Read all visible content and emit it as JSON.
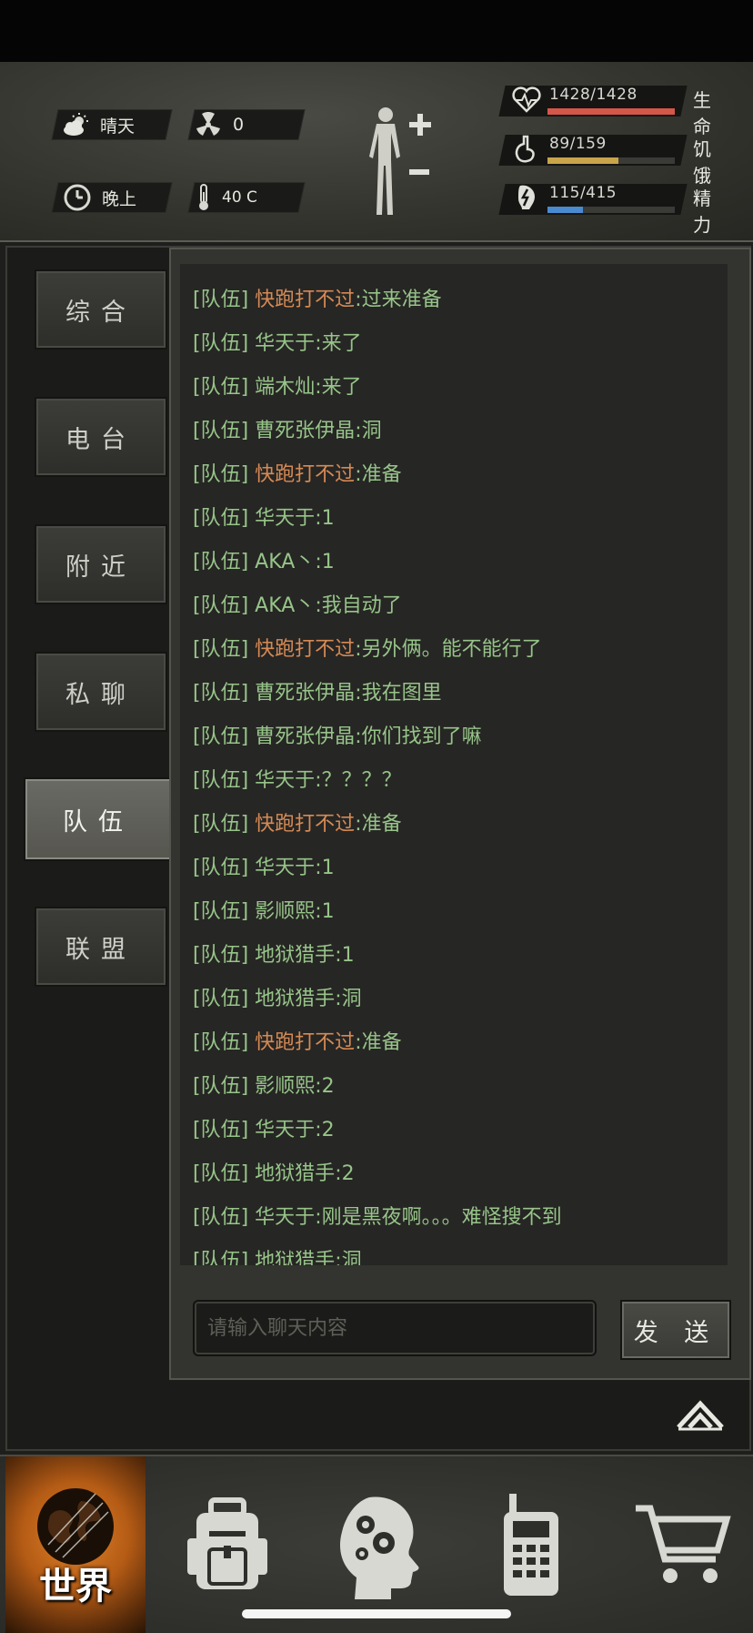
{
  "status": {
    "weather": "晴天",
    "radiation": "0",
    "time_of_day": "晚上",
    "temperature": "40 C"
  },
  "stats": [
    {
      "value": "1428/1428",
      "label": "生命",
      "fill": 1.0,
      "color": "#d4574a",
      "icon": "heart-icon"
    },
    {
      "value": "89/159",
      "label": "饥饿",
      "fill": 0.56,
      "color": "#c8a44a",
      "icon": "stomach-icon"
    },
    {
      "value": "115/415",
      "label": "精力",
      "fill": 0.28,
      "color": "#4a8ad0",
      "icon": "energy-icon"
    }
  ],
  "tabs": [
    {
      "label": "综合",
      "active": false
    },
    {
      "label": "电台",
      "active": false
    },
    {
      "label": "附近",
      "active": false
    },
    {
      "label": "私聊",
      "active": false
    },
    {
      "label": "队伍",
      "active": true
    },
    {
      "label": "联盟",
      "active": false
    }
  ],
  "messages": [
    {
      "channel": "[队伍]",
      "sender": "快跑打不过",
      "orange": true,
      "text": ":过来准备"
    },
    {
      "channel": "[队伍]",
      "sender": "华天于",
      "orange": false,
      "text": ":来了"
    },
    {
      "channel": "[队伍]",
      "sender": "端木灿",
      "orange": false,
      "text": ":来了"
    },
    {
      "channel": "[队伍]",
      "sender": "曹死张伊晶",
      "orange": false,
      "text": ":洞"
    },
    {
      "channel": "[队伍]",
      "sender": "快跑打不过",
      "orange": true,
      "text": ":准备"
    },
    {
      "channel": "[队伍]",
      "sender": "华天于",
      "orange": false,
      "text": ":1"
    },
    {
      "channel": "[队伍]",
      "sender": "AKA丶",
      "orange": false,
      "text": ":1"
    },
    {
      "channel": "[队伍]",
      "sender": "AKA丶",
      "orange": false,
      "text": ":我自动了"
    },
    {
      "channel": "[队伍]",
      "sender": "快跑打不过",
      "orange": true,
      "text": ":另外俩。能不能行了"
    },
    {
      "channel": "[队伍]",
      "sender": "曹死张伊晶",
      "orange": false,
      "text": ":我在图里"
    },
    {
      "channel": "[队伍]",
      "sender": "曹死张伊晶",
      "orange": false,
      "text": ":你们找到了嘛"
    },
    {
      "channel": "[队伍]",
      "sender": "华天于",
      "orange": false,
      "text": ":？？？？"
    },
    {
      "channel": "[队伍]",
      "sender": "快跑打不过",
      "orange": true,
      "text": ":准备"
    },
    {
      "channel": "[队伍]",
      "sender": "华天于",
      "orange": false,
      "text": ":1"
    },
    {
      "channel": "[队伍]",
      "sender": "影顺熙",
      "orange": false,
      "text": ":1"
    },
    {
      "channel": "[队伍]",
      "sender": "地狱猎手",
      "orange": false,
      "text": ":1"
    },
    {
      "channel": "[队伍]",
      "sender": "地狱猎手",
      "orange": false,
      "text": ":洞"
    },
    {
      "channel": "[队伍]",
      "sender": "快跑打不过",
      "orange": true,
      "text": ":准备"
    },
    {
      "channel": "[队伍]",
      "sender": "影顺熙",
      "orange": false,
      "text": ":2"
    },
    {
      "channel": "[队伍]",
      "sender": "华天于",
      "orange": false,
      "text": ":2"
    },
    {
      "channel": "[队伍]",
      "sender": "地狱猎手",
      "orange": false,
      "text": ":2"
    },
    {
      "channel": "[队伍]",
      "sender": "华天于",
      "orange": false,
      "text": ":刚是黑夜啊。。。难怪搜不到"
    },
    {
      "channel": "[队伍]",
      "sender": "地狱猎手",
      "orange": false,
      "text": ":洞"
    }
  ],
  "input": {
    "placeholder": "请输入聊天内容",
    "value": ""
  },
  "send_label": "发 送",
  "nav": [
    {
      "label": "世界",
      "icon": "globe-icon",
      "active": true
    },
    {
      "label": "",
      "icon": "backpack-icon",
      "active": false
    },
    {
      "label": "",
      "icon": "brain-head-icon",
      "active": false
    },
    {
      "label": "",
      "icon": "radio-icon",
      "active": false
    },
    {
      "label": "",
      "icon": "cart-icon",
      "active": false
    }
  ]
}
